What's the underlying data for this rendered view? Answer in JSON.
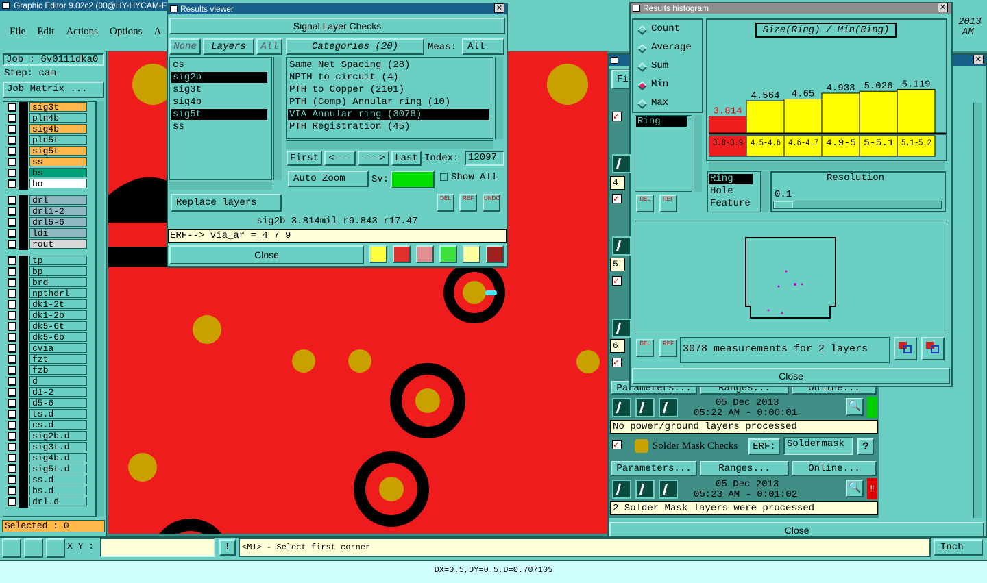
{
  "app": {
    "title": "Graphic Editor 9.02c2 (00@HY-HYCAM-F",
    "menu": [
      "File",
      "Edit",
      "Actions",
      "Options",
      "A"
    ],
    "date_right": "2013",
    "time_right": "AM"
  },
  "left": {
    "job": "Job : 6v0111dka0",
    "step": "Step: cam",
    "job_matrix": "Job Matrix ...",
    "selected": "Selected : 0",
    "layers": [
      {
        "name": "sig3t",
        "color": "#ffb74a"
      },
      {
        "name": "pln4b",
        "color": "#6bd0c3"
      },
      {
        "name": "sig4b",
        "color": "#ffb74a"
      },
      {
        "name": "pln5t",
        "color": "#6bd0c3"
      },
      {
        "name": "sig5t",
        "color": "#ffb74a",
        "flag": "✎"
      },
      {
        "name": "ss",
        "color": "#ffb74a",
        "flag": "✎"
      },
      {
        "name": "bs",
        "color": "#00a07a"
      },
      {
        "name": "bo",
        "color": "#ffffff"
      },
      {
        "name": "drl",
        "color": "#8fb7bf"
      },
      {
        "name": "drl1-2",
        "color": "#8fb7bf"
      },
      {
        "name": "drl5-6",
        "color": "#8fb7bf"
      },
      {
        "name": "ldi",
        "color": "#8fb7bf"
      },
      {
        "name": "rout",
        "color": "#d8d8d8"
      },
      {
        "name": "tp",
        "color": "#6bd0c3"
      },
      {
        "name": "bp",
        "color": "#6bd0c3"
      },
      {
        "name": "brd",
        "color": "#6bd0c3"
      },
      {
        "name": "npthdrl",
        "color": "#6bd0c3"
      },
      {
        "name": "dk1-2t",
        "color": "#6bd0c3"
      },
      {
        "name": "dk1-2b",
        "color": "#6bd0c3"
      },
      {
        "name": "dk5-6t",
        "color": "#6bd0c3"
      },
      {
        "name": "dk5-6b",
        "color": "#6bd0c3"
      },
      {
        "name": "cvia",
        "color": "#6bd0c3"
      },
      {
        "name": "fzt",
        "color": "#6bd0c3"
      },
      {
        "name": "fzb",
        "color": "#6bd0c3"
      },
      {
        "name": "d",
        "color": "#6bd0c3"
      },
      {
        "name": "d1-2",
        "color": "#6bd0c3"
      },
      {
        "name": "d5-6",
        "color": "#6bd0c3"
      },
      {
        "name": "ts.d",
        "color": "#6bd0c3"
      },
      {
        "name": "cs.d",
        "color": "#6bd0c3"
      },
      {
        "name": "sig2b.d",
        "color": "#6bd0c3",
        "flag": "✎"
      },
      {
        "name": "sig3t.d",
        "color": "#6bd0c3"
      },
      {
        "name": "sig4b.d",
        "color": "#6bd0c3"
      },
      {
        "name": "sig5t.d",
        "color": "#6bd0c3",
        "flag": "✎"
      },
      {
        "name": "ss.d",
        "color": "#6bd0c3",
        "flag": "✎"
      },
      {
        "name": "bs.d",
        "color": "#6bd0c3"
      },
      {
        "name": "drl.d",
        "color": "#6bd0c3"
      }
    ]
  },
  "viewer": {
    "title": "Results viewer",
    "header": "Signal Layer Checks",
    "none": "None",
    "layers_tab": "Layers",
    "all": "All",
    "layers": [
      "cs",
      "sig2b",
      "sig3t",
      "sig4b",
      "sig5t",
      "ss"
    ],
    "categories_label": "Categories (20)",
    "meas_label": "Meas:",
    "meas_value": "All",
    "categories": [
      "Same Net Spacing (28)",
      "NPTH to circuit (4)",
      "PTH to Copper (2101)",
      "PTH (Comp) Annular ring (10)",
      "VIA Annular ring (3078)",
      "PTH Registration (45)"
    ],
    "first": "First",
    "prev": "<---",
    "next": "--->",
    "last": "Last",
    "index_label": "Index:",
    "index_value": "12097",
    "auto_zoom": "Auto Zoom",
    "sv": "Sv:",
    "show_all": "Show All",
    "replace_layers": "Replace layers",
    "del": "DEL",
    "ref": "REF",
    "undo": "UNDO",
    "status": "sig2b 3.814mil  r9.843  r17.47",
    "erf": "ERF--> via_ar = 4 7 9",
    "close": "Close"
  },
  "histogram": {
    "title": "Results histogram",
    "modes": [
      "Count",
      "Average",
      "Sum",
      "Min",
      "Max"
    ],
    "active_mode": "Min",
    "chart_title": "Size(Ring) / Min(Ring)",
    "measure_list": [
      "Ring"
    ],
    "measure_list2": [
      "Ring",
      "Hole",
      "Feature"
    ],
    "resolution_label": "Resolution",
    "resolution_value": "0.1",
    "summary": "3078 measurements for 2 layers",
    "close": "Close",
    "del": "DEL",
    "ref": "REF"
  },
  "chart_data": {
    "type": "bar",
    "categories": [
      "3.8-3.9",
      "4.5-4.6",
      "4.6-4.7",
      "4.9-5",
      "5-5.1",
      "5.1-5.2"
    ],
    "values": [
      3.814,
      4.564,
      4.65,
      4.933,
      5.026,
      5.119
    ],
    "labels": [
      "3.814",
      "4.564",
      "4.65",
      "4.933",
      "5.026",
      "5.119"
    ],
    "colors": [
      "#ee1c1c",
      "#ffff00",
      "#ffff00",
      "#ffff00",
      "#ffff00",
      "#ffff00"
    ]
  },
  "checklist": {
    "date1": "05 Dec 2013",
    "time1": "05:22 AM - 0:00:01",
    "msg1": "No power/ground layers processed",
    "params": "Parameters...",
    "ranges": "Ranges...",
    "online": "Online...",
    "solder_title": "Solder Mask Checks",
    "erf": "ERF:",
    "erf_value": "Soldermask",
    "help": "?",
    "date2": "05 Dec 2013",
    "time2": "05:23 AM - 0:01:02",
    "msg2": "2 Solder Mask layers were processed",
    "close": "Close",
    "side_nums": [
      "4",
      "5",
      "6"
    ],
    "partial": "Fi",
    "partial2": "c",
    "partial3": "I"
  },
  "bottom": {
    "xy_label": "X Y :",
    "prompt": "<M1> - Select first corner",
    "units": "Inch",
    "status": "DX=0.5,DY=0.5,D=0.707105",
    "bang": "!"
  }
}
